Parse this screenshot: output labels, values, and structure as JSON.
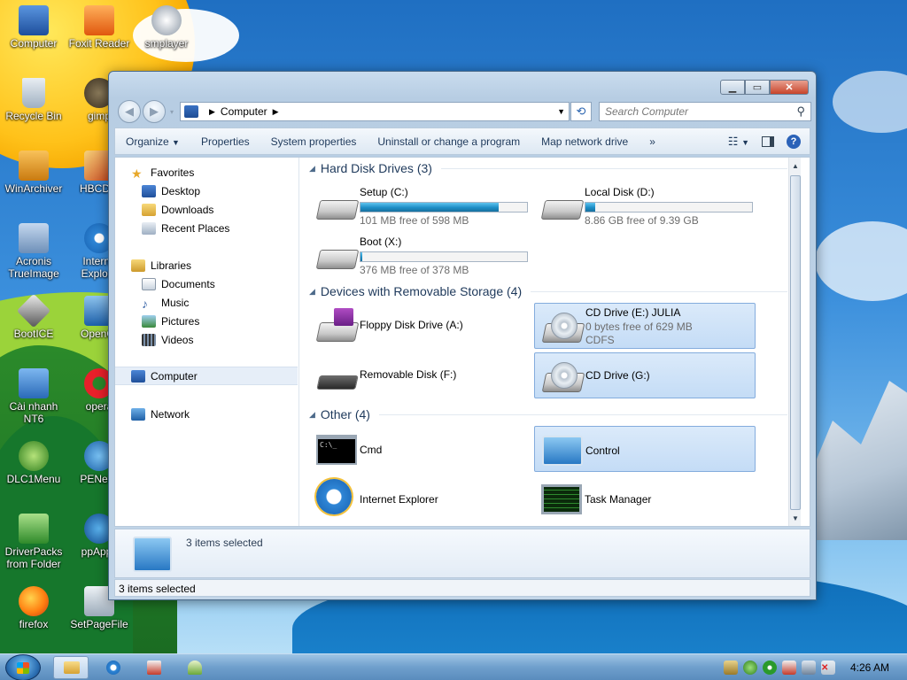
{
  "desktop": {
    "icons": [
      {
        "label": "Computer"
      },
      {
        "label": "Foxit Reader"
      },
      {
        "label": "smplayer"
      },
      {
        "label": "Recycle Bin"
      },
      {
        "label": "gimp"
      },
      {
        "label": "WinArchiver"
      },
      {
        "label": "HBCDM"
      },
      {
        "label": "Acronis TrueImage"
      },
      {
        "label": "Interne Explore"
      },
      {
        "label": "BootICE"
      },
      {
        "label": "OpenOf"
      },
      {
        "label": "Cài nhanh NT6"
      },
      {
        "label": "opera"
      },
      {
        "label": "DLC1Menu"
      },
      {
        "label": "PENetw"
      },
      {
        "label": "DriverPacks from Folder"
      },
      {
        "label": "ppApps"
      },
      {
        "label": "firefox"
      },
      {
        "label": "SetPageFile"
      }
    ]
  },
  "window": {
    "address": {
      "location": "Computer"
    },
    "search": {
      "placeholder": "Search Computer"
    },
    "toolbar": {
      "organize": "Organize",
      "properties": "Properties",
      "system_properties": "System properties",
      "uninstall": "Uninstall or change a program",
      "map_drive": "Map network drive",
      "more": "»"
    },
    "nav": {
      "favorites": "Favorites",
      "desktop": "Desktop",
      "downloads": "Downloads",
      "recent": "Recent Places",
      "libraries": "Libraries",
      "documents": "Documents",
      "music": "Music",
      "pictures": "Pictures",
      "videos": "Videos",
      "computer": "Computer",
      "network": "Network"
    },
    "groups": {
      "hdd": "Hard Disk Drives (3)",
      "removable": "Devices with Removable Storage (4)",
      "other": "Other (4)"
    },
    "drives": [
      {
        "name": "Setup (C:)",
        "free": "101 MB free of 598 MB",
        "used_fraction": 0.83
      },
      {
        "name": "Local Disk (D:)",
        "free": "8.86 GB free of 9.39 GB",
        "used_fraction": 0.06
      },
      {
        "name": "Boot (X:)",
        "free": "376 MB free of 378 MB",
        "used_fraction": 0.01
      }
    ],
    "removable": [
      {
        "name": "Floppy Disk Drive (A:)"
      },
      {
        "name": "CD Drive (E:) JULIA",
        "free": "0 bytes free of 629 MB",
        "fs": "CDFS"
      },
      {
        "name": "Removable Disk (F:)"
      },
      {
        "name": "CD Drive (G:)"
      }
    ],
    "other": [
      {
        "name": "Cmd"
      },
      {
        "name": "Control"
      },
      {
        "name": "Internet Explorer"
      },
      {
        "name": "Task Manager"
      }
    ],
    "details": {
      "text": "3 items selected"
    },
    "status": {
      "text": "3 items selected"
    }
  },
  "taskbar": {
    "clock": "4:26 AM"
  },
  "colors": {
    "accent": "#1d8ec6",
    "group_heading": "#1e395b",
    "selection": "#c4dcf6"
  }
}
